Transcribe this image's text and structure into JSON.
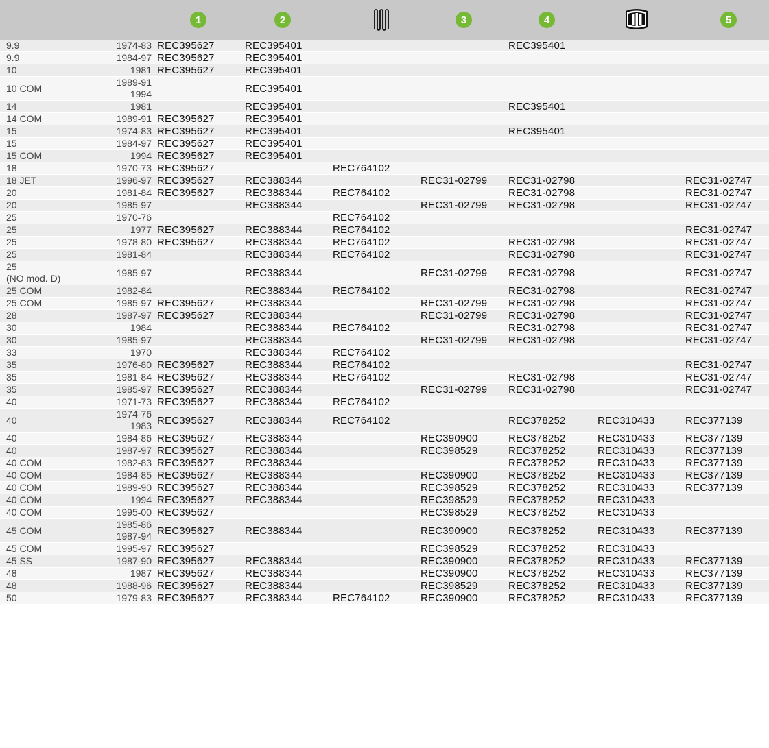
{
  "header": {
    "col1_label": "1",
    "col2_label": "2",
    "col3_icon": "coil-spring-icon",
    "col4_label": "3",
    "col5_label": "4",
    "col6_icon": "cylinder-drum-icon",
    "col7_label": "5",
    "accent_color": "#76b935",
    "header_bg": "#c8c8c8"
  },
  "rows": [
    {
      "model": "9.9",
      "years": "1974-83",
      "p1": "REC395627",
      "p2": "REC395401",
      "p3": "",
      "p4": "",
      "p5": "REC395401",
      "p6": "",
      "p7": ""
    },
    {
      "model": "9.9",
      "years": "1984-97",
      "p1": "REC395627",
      "p2": "REC395401",
      "p3": "",
      "p4": "",
      "p5": "",
      "p6": "",
      "p7": ""
    },
    {
      "model": "10",
      "years": "1981",
      "p1": "REC395627",
      "p2": "REC395401",
      "p3": "",
      "p4": "",
      "p5": "",
      "p6": "",
      "p7": ""
    },
    {
      "model": "10 COM",
      "years": "1989-91",
      "years2": "1994",
      "p1": "",
      "p2": "REC395401",
      "p3": "",
      "p4": "",
      "p5": "",
      "p6": "",
      "p7": ""
    },
    {
      "model": "14",
      "years": "1981",
      "p1": "",
      "p2": "REC395401",
      "p3": "",
      "p4": "",
      "p5": "REC395401",
      "p6": "",
      "p7": ""
    },
    {
      "model": "14 COM",
      "years": "1989-91",
      "p1": "REC395627",
      "p2": "REC395401",
      "p3": "",
      "p4": "",
      "p5": "",
      "p6": "",
      "p7": ""
    },
    {
      "model": "15",
      "years": "1974-83",
      "p1": "REC395627",
      "p2": "REC395401",
      "p3": "",
      "p4": "",
      "p5": "REC395401",
      "p6": "",
      "p7": ""
    },
    {
      "model": "15",
      "years": "1984-97",
      "p1": "REC395627",
      "p2": "REC395401",
      "p3": "",
      "p4": "",
      "p5": "",
      "p6": "",
      "p7": ""
    },
    {
      "model": "15 COM",
      "years": "1994",
      "p1": "REC395627",
      "p2": "REC395401",
      "p3": "",
      "p4": "",
      "p5": "",
      "p6": "",
      "p7": ""
    },
    {
      "model": "18",
      "years": "1970-73",
      "p1": "REC395627",
      "p2": "",
      "p3": "REC764102",
      "p4": "",
      "p5": "",
      "p6": "",
      "p7": ""
    },
    {
      "model": "18 JET",
      "years": "1996-97",
      "p1": "REC395627",
      "p2": "REC388344",
      "p3": "",
      "p4": "REC31-02799",
      "p5": "REC31-02798",
      "p6": "",
      "p7": "REC31-02747"
    },
    {
      "model": "20",
      "years": "1981-84",
      "p1": "REC395627",
      "p2": "REC388344",
      "p3": "REC764102",
      "p4": "",
      "p5": "REC31-02798",
      "p6": "",
      "p7": "REC31-02747"
    },
    {
      "model": "20",
      "years": "1985-97",
      "p1": "",
      "p2": "REC388344",
      "p3": "",
      "p4": "REC31-02799",
      "p5": "REC31-02798",
      "p6": "",
      "p7": "REC31-02747"
    },
    {
      "model": "25",
      "years": "1970-76",
      "p1": "",
      "p2": "",
      "p3": "REC764102",
      "p4": "",
      "p5": "",
      "p6": "",
      "p7": ""
    },
    {
      "model": "25",
      "years": "1977",
      "p1": "REC395627",
      "p2": "REC388344",
      "p3": "REC764102",
      "p4": "",
      "p5": "",
      "p6": "",
      "p7": "REC31-02747"
    },
    {
      "model": "25",
      "years": "1978-80",
      "p1": "REC395627",
      "p2": "REC388344",
      "p3": "REC764102",
      "p4": "",
      "p5": "REC31-02798",
      "p6": "",
      "p7": "REC31-02747"
    },
    {
      "model": "25",
      "years": "1981-84",
      "p1": "",
      "p2": "REC388344",
      "p3": "REC764102",
      "p4": "",
      "p5": "REC31-02798",
      "p6": "",
      "p7": "REC31-02747"
    },
    {
      "model": "25",
      "model2": "(NO mod. D)",
      "years": "1985-97",
      "p1": "",
      "p2": "REC388344",
      "p3": "",
      "p4": "REC31-02799",
      "p5": "REC31-02798",
      "p6": "",
      "p7": "REC31-02747"
    },
    {
      "model": "25 COM",
      "years": "1982-84",
      "p1": "",
      "p2": "REC388344",
      "p3": "REC764102",
      "p4": "",
      "p5": "REC31-02798",
      "p6": "",
      "p7": "REC31-02747"
    },
    {
      "model": "25 COM",
      "years": "1985-97",
      "p1": "REC395627",
      "p2": "REC388344",
      "p3": "",
      "p4": "REC31-02799",
      "p5": "REC31-02798",
      "p6": "",
      "p7": "REC31-02747"
    },
    {
      "model": "28",
      "years": "1987-97",
      "p1": "REC395627",
      "p2": "REC388344",
      "p3": "",
      "p4": "REC31-02799",
      "p5": "REC31-02798",
      "p6": "",
      "p7": "REC31-02747"
    },
    {
      "model": "30",
      "years": "1984",
      "p1": "",
      "p2": "REC388344",
      "p3": "REC764102",
      "p4": "",
      "p5": "REC31-02798",
      "p6": "",
      "p7": "REC31-02747"
    },
    {
      "model": "30",
      "years": "1985-97",
      "p1": "",
      "p2": "REC388344",
      "p3": "",
      "p4": "REC31-02799",
      "p5": "REC31-02798",
      "p6": "",
      "p7": "REC31-02747"
    },
    {
      "model": "33",
      "years": "1970",
      "p1": "",
      "p2": "REC388344",
      "p3": "REC764102",
      "p4": "",
      "p5": "",
      "p6": "",
      "p7": ""
    },
    {
      "model": "35",
      "years": "1976-80",
      "p1": "REC395627",
      "p2": "REC388344",
      "p3": "REC764102",
      "p4": "",
      "p5": "",
      "p6": "",
      "p7": "REC31-02747"
    },
    {
      "model": "35",
      "years": "1981-84",
      "p1": "REC395627",
      "p2": "REC388344",
      "p3": "REC764102",
      "p4": "",
      "p5": "REC31-02798",
      "p6": "",
      "p7": "REC31-02747"
    },
    {
      "model": "35",
      "years": "1985-97",
      "p1": "REC395627",
      "p2": "REC388344",
      "p3": "",
      "p4": "REC31-02799",
      "p5": "REC31-02798",
      "p6": "",
      "p7": "REC31-02747"
    },
    {
      "model": "40",
      "years": "1971-73",
      "p1": "REC395627",
      "p2": "REC388344",
      "p3": "REC764102",
      "p4": "",
      "p5": "",
      "p6": "",
      "p7": ""
    },
    {
      "model": "40",
      "years": "1974-76",
      "years2": "1983",
      "p1": "REC395627",
      "p2": "REC388344",
      "p3": "REC764102",
      "p4": "",
      "p5": "REC378252",
      "p6": "REC310433",
      "p7": "REC377139"
    },
    {
      "model": "40",
      "years": "1984-86",
      "p1": "REC395627",
      "p2": "REC388344",
      "p3": "",
      "p4": "REC390900",
      "p5": "REC378252",
      "p6": "REC310433",
      "p7": "REC377139"
    },
    {
      "model": "40",
      "years": "1987-97",
      "p1": "REC395627",
      "p2": "REC388344",
      "p3": "",
      "p4": "REC398529",
      "p5": "REC378252",
      "p6": "REC310433",
      "p7": "REC377139"
    },
    {
      "model": "40 COM",
      "years": "1982-83",
      "p1": "REC395627",
      "p2": "REC388344",
      "p3": "",
      "p4": "",
      "p5": "REC378252",
      "p6": "REC310433",
      "p7": "REC377139"
    },
    {
      "model": "40 COM",
      "years": "1984-85",
      "p1": "REC395627",
      "p2": "REC388344",
      "p3": "",
      "p4": "REC390900",
      "p5": "REC378252",
      "p6": "REC310433",
      "p7": "REC377139"
    },
    {
      "model": "40 COM",
      "years": "1989-90",
      "p1": "REC395627",
      "p2": "REC388344",
      "p3": "",
      "p4": "REC398529",
      "p5": "REC378252",
      "p6": "REC310433",
      "p7": "REC377139"
    },
    {
      "model": "40 COM",
      "years": "1994",
      "p1": "REC395627",
      "p2": "REC388344",
      "p3": "",
      "p4": "REC398529",
      "p5": "REC378252",
      "p6": "REC310433",
      "p7": ""
    },
    {
      "model": "40 COM",
      "years": "1995-00",
      "p1": "REC395627",
      "p2": "",
      "p3": "",
      "p4": "REC398529",
      "p5": "REC378252",
      "p6": "REC310433",
      "p7": ""
    },
    {
      "model": "45 COM",
      "years": "1985-86",
      "years2": "1987-94",
      "p1": "REC395627",
      "p2": "REC388344",
      "p3": "",
      "p4": "REC390900",
      "p5": "REC378252",
      "p6": "REC310433",
      "p7": "REC377139"
    },
    {
      "model": "45 COM",
      "years": "1995-97",
      "p1": "REC395627",
      "p2": "",
      "p3": "",
      "p4": "REC398529",
      "p5": "REC378252",
      "p6": "REC310433",
      "p7": ""
    },
    {
      "model": "45 SS",
      "years": "1987-90",
      "p1": "REC395627",
      "p2": "REC388344",
      "p3": "",
      "p4": "REC390900",
      "p5": "REC378252",
      "p6": "REC310433",
      "p7": "REC377139"
    },
    {
      "model": "48",
      "years": "1987",
      "p1": "REC395627",
      "p2": "REC388344",
      "p3": "",
      "p4": "REC390900",
      "p5": "REC378252",
      "p6": "REC310433",
      "p7": "REC377139"
    },
    {
      "model": "48",
      "years": "1988-96",
      "p1": "REC395627",
      "p2": "REC388344",
      "p3": "",
      "p4": "REC398529",
      "p5": "REC378252",
      "p6": "REC310433",
      "p7": "REC377139"
    },
    {
      "model": "50",
      "years": "1979-83",
      "p1": "REC395627",
      "p2": "REC388344",
      "p3": "REC764102",
      "p4": "REC390900",
      "p5": "REC378252",
      "p6": "REC310433",
      "p7": "REC377139"
    }
  ]
}
